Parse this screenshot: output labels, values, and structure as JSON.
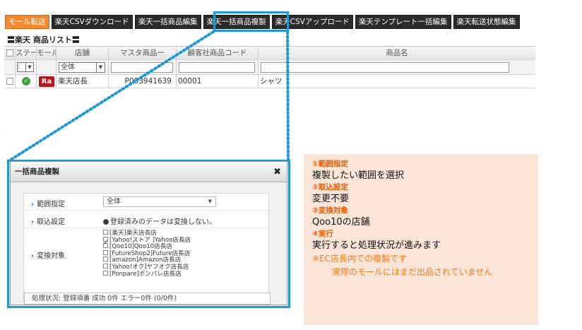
{
  "toolbar": {
    "buttons": [
      {
        "label": "モール転送"
      },
      {
        "label": "楽天CSVダウンロード"
      },
      {
        "label": "楽天一括商品編集"
      },
      {
        "label": "楽天一括商品複製"
      },
      {
        "label": "楽天CSVアップロード"
      },
      {
        "label": "楽天テンプレート一括編集"
      },
      {
        "label": "楽天転送状態編集"
      }
    ]
  },
  "list": {
    "title": "〓楽天 商品リスト〓",
    "columns": [
      "ステー",
      "モール",
      "店舗",
      "マスタ商品ー",
      "顧客社商品コード",
      "商品名"
    ],
    "filter": {
      "status_value": ":",
      "store_value": "全体"
    },
    "rows": [
      {
        "mall_badge": "Ra",
        "store": "楽天店長",
        "master_code": "P003941639",
        "customer_code": "00001",
        "name": "シャツ"
      }
    ]
  },
  "dialog": {
    "title": "一括商品複製",
    "range_label": "範囲指定",
    "range_value": "全体",
    "import_label": "取込設定",
    "import_value": "登録済みのデータは変換しない。",
    "target_label": "変換対象",
    "targets": [
      {
        "label": "[楽天]楽天店長店",
        "checked": false
      },
      {
        "label": "[Yahoo!ストア ]Yahoo店長店",
        "checked": false
      },
      {
        "label": "[Qoo10]Qoo10店長店",
        "checked": true
      },
      {
        "label": "[FutureShop2]Future店長店",
        "checked": false
      },
      {
        "label": "[amazon]Amazon店長店",
        "checked": false
      },
      {
        "label": "[Yahoo!オク]ヤフオク店長店",
        "checked": false
      },
      {
        "label": "[Ponpare]ポンパレ店長店",
        "checked": false
      }
    ],
    "status_text": "処理状況: 登録項番 成功 0件 エラー0件 (0/0件)"
  },
  "note": {
    "step1_title": "①範囲指定",
    "step1_text": "複製したい範囲を選択",
    "step2_title": "②取込設定",
    "step2_text": "変更不要",
    "step3_title": "③変換対象",
    "step3_text": "Qoo10の店舗",
    "step4_title": "④実行",
    "step4_text": "実行すると処理状況が進みます",
    "warning1": "※EC店長内での複製です",
    "warning2": "実際のモールにはまだ出品されていません"
  },
  "colors": {
    "highlight": "#1f97d4",
    "toolbar_active": "#f08a2e",
    "note_background": "#fbe5d6",
    "note_accent": "#e85a00",
    "rakuten_badge": "#b4161d"
  }
}
